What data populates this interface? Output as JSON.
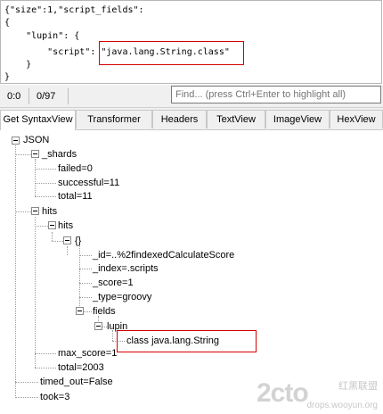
{
  "request": {
    "lines": [
      "{\"size\":1,\"script_fields\":",
      "{",
      "    \"lupin\": {",
      "        \"script\": \"java.lang.String.class\"",
      "    }",
      "}"
    ]
  },
  "status": {
    "position": "0:0",
    "count": "0/97",
    "find_placeholder": "Find... (press Ctrl+Enter to highlight all)"
  },
  "tabs": [
    "Get SyntaxView",
    "Transformer",
    "Headers",
    "TextView",
    "ImageView",
    "HexView"
  ],
  "active_tab": "Get SyntaxView",
  "tree": {
    "root": "JSON",
    "shards": "_shards",
    "failed": "failed=0",
    "successful": "successful=11",
    "total_shards": "total=11",
    "hits": "hits",
    "hits_inner": "hits",
    "obj": "{}",
    "id": "_id=..%2findexedCalculateScore",
    "index": "_index=.scripts",
    "score": "_score=1",
    "type": "_type=groovy",
    "fields": "fields",
    "lupin": "lupin",
    "class_value": "class java.lang.String",
    "max_score": "max_score=1",
    "total_hits": "total=2003",
    "timed_out": "timed_out=False",
    "took": "took=3"
  },
  "watermark": {
    "brand": "2cto",
    "cn": "红黑联盟",
    "url": "drops.wooyun.org"
  },
  "colors": {
    "highlight": "#d40000",
    "panel": "#f0f0f0"
  }
}
